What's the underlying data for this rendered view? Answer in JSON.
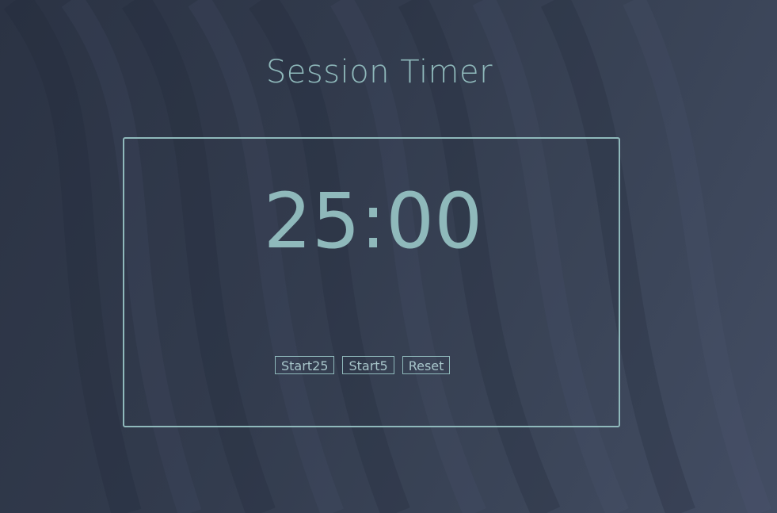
{
  "page": {
    "title": "Session Timer"
  },
  "timer": {
    "display": "25:00"
  },
  "controls": {
    "start25_label": "Start25",
    "start5_label": "Start5",
    "reset_label": "Reset"
  },
  "theme": {
    "accent": "#8fb9bb",
    "background": "#323b4d"
  }
}
